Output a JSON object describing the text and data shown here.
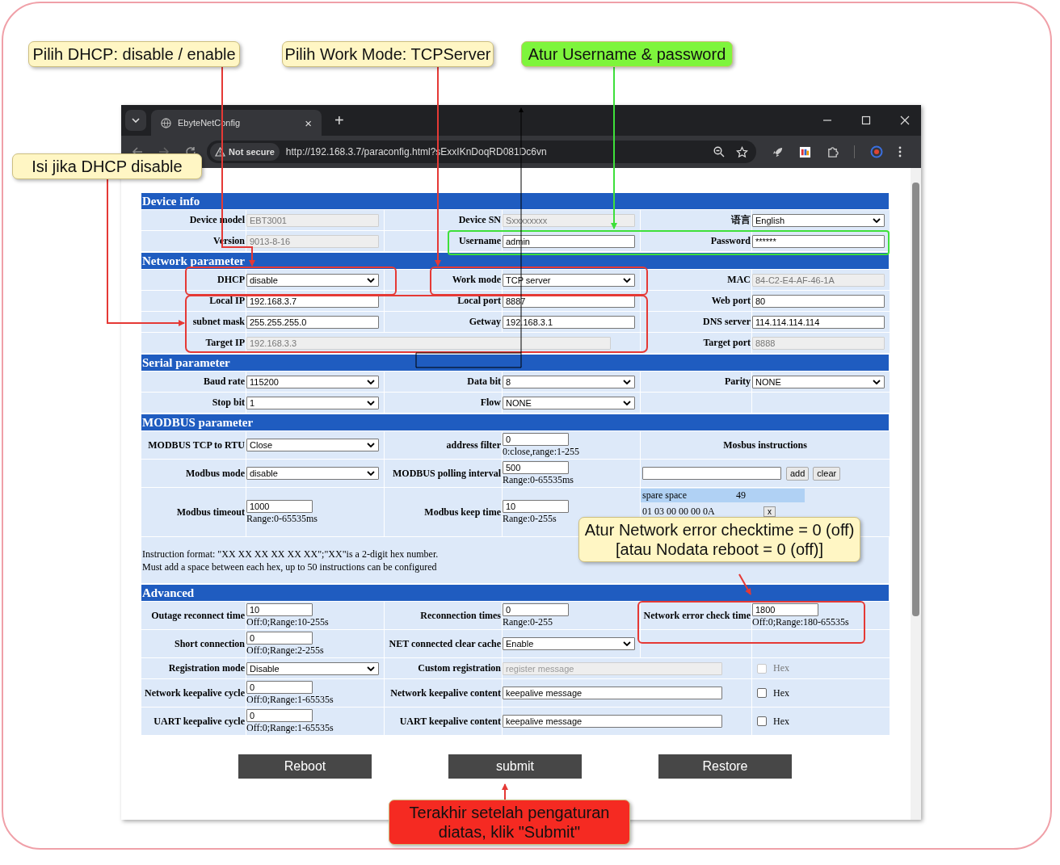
{
  "browser": {
    "tab_title": "EbyteNetConfig",
    "tab_close": "×",
    "new_tab": "+",
    "security": "Not secure",
    "url": "http://192.168.3.7/paraconfig.html?sExxIKnDoqRD081Dc6vn"
  },
  "sections": [
    {
      "title": "Device info",
      "rows": [
        [
          {
            "label": "Device model",
            "kind": "readonly",
            "value": "EBT3001"
          },
          {
            "label": "Device SN",
            "kind": "readonly",
            "value": "Sxxxxxxxx"
          },
          {
            "label": "语言",
            "kind": "select",
            "value": "English"
          }
        ],
        [
          {
            "label": "Version",
            "kind": "readonly",
            "value": "9013-8-16"
          },
          {
            "label": "Username",
            "kind": "input",
            "value": "admin"
          },
          {
            "label": "Password",
            "kind": "input",
            "value": "******"
          }
        ]
      ]
    },
    {
      "title": "Network parameter",
      "rows": [
        [
          {
            "label": "DHCP",
            "kind": "select",
            "value": "disable"
          },
          {
            "label": "Work mode",
            "kind": "select",
            "value": "TCP server"
          },
          {
            "label": "MAC",
            "kind": "readonly",
            "value": "84-C2-E4-AF-46-1A"
          }
        ],
        [
          {
            "label": "Local IP",
            "kind": "input",
            "value": "192.168.3.7"
          },
          {
            "label": "Local port",
            "kind": "input",
            "value": "8887"
          },
          {
            "label": "Web port",
            "kind": "input",
            "value": "80"
          }
        ],
        [
          {
            "label": "subnet mask",
            "kind": "input",
            "value": "255.255.255.0"
          },
          {
            "label": "Getway",
            "kind": "input",
            "value": "192.168.3.1"
          },
          {
            "label": "DNS server",
            "kind": "input",
            "value": "114.114.114.114"
          }
        ],
        [
          {
            "label": "Target IP",
            "kind": "readonly",
            "value": "192.168.3.3",
            "wide": true
          },
          null,
          {
            "label": "Target port",
            "kind": "readonly",
            "value": "8888"
          }
        ]
      ]
    },
    {
      "title": "Serial parameter",
      "rows": [
        [
          {
            "label": "Baud rate",
            "kind": "select",
            "value": "115200"
          },
          {
            "label": "Data bit",
            "kind": "select",
            "value": "8"
          },
          {
            "label": "Parity",
            "kind": "select",
            "value": "NONE"
          }
        ],
        [
          {
            "label": "Stop bit",
            "kind": "select",
            "value": "1"
          },
          {
            "label": "Flow",
            "kind": "select",
            "value": "NONE"
          },
          null
        ]
      ]
    },
    {
      "title": "MODBUS parameter",
      "rows": [
        [
          {
            "label": "MODBUS TCP to RTU",
            "kind": "select",
            "value": "Close"
          },
          {
            "label": "address filter",
            "kind": "input",
            "value": "0",
            "hint": "0:close,range:1-255"
          },
          {
            "label": "Mosbus instructions",
            "kind": "heading"
          }
        ],
        [
          {
            "label": "Modbus mode",
            "kind": "select",
            "value": "disable"
          },
          {
            "label": "MODBUS polling interval",
            "kind": "input",
            "value": "500",
            "hint": "Range:0-65535ms"
          },
          {
            "kind": "instr-entry",
            "buttons": [
              "add",
              "clear"
            ]
          }
        ],
        [
          {
            "label": "Modbus timeout",
            "kind": "input",
            "value": "1000",
            "hint": "Range:0-65535ms"
          },
          {
            "label": "Modbus keep time",
            "kind": "input",
            "value": "10",
            "hint": "Range:0-255s"
          },
          {
            "kind": "instr-list",
            "label": "spare space",
            "value": "49",
            "entries": [
              {
                "text": "01 03 00 00 00 0A",
                "button": "x"
              }
            ]
          }
        ]
      ],
      "note": [
        "Instruction format: \"XX XX XX XX XX XX\";\"XX\"is a 2-digit hex number.",
        "Must add a space between each hex, up to 50 instructions can be configured"
      ]
    },
    {
      "title": "Advanced",
      "rows": [
        [
          {
            "label": "Outage reconnect time",
            "kind": "input",
            "value": "10",
            "hint": "Off:0;Range:10-255s"
          },
          {
            "label": "Reconnection times",
            "kind": "input",
            "value": "0",
            "hint": "Range:0-255"
          },
          {
            "label": "Network error check time",
            "kind": "input",
            "value": "1800",
            "hint": "Off:0;Range:180-65535s"
          }
        ],
        [
          {
            "label": "Short connection",
            "kind": "input",
            "value": "0",
            "hint": "Off:0;Range:2-255s"
          },
          {
            "label": "NET connected clear cache",
            "kind": "select",
            "value": "Enable"
          },
          null
        ],
        [
          {
            "label": "Registration mode",
            "kind": "select",
            "value": "Disable"
          },
          {
            "label": "Custom registration",
            "kind": "readonly",
            "placeholder": "register message",
            "wide": true
          },
          {
            "kind": "checkbox",
            "text": "Hex",
            "checked": false,
            "disabled": true
          }
        ],
        [
          {
            "label": "Network keepalive cycle",
            "kind": "input",
            "value": "0",
            "hint": "Off:0;Range:1-65535s"
          },
          {
            "label": "Network keepalive content",
            "kind": "input",
            "value": "keepalive message",
            "wide": true
          },
          {
            "kind": "checkbox",
            "text": "Hex",
            "checked": false,
            "disabled": false
          }
        ],
        [
          {
            "label": "UART keepalive cycle",
            "kind": "input",
            "value": "0",
            "hint": "Off:0;Range:1-65535s"
          },
          {
            "label": "UART keepalive content",
            "kind": "input",
            "value": "keepalive message",
            "wide": true
          },
          {
            "kind": "checkbox",
            "text": "Hex",
            "checked": false,
            "disabled": false
          }
        ]
      ]
    }
  ],
  "buttons": [
    "Reboot",
    "submit",
    "Restore"
  ],
  "annotations": [
    {
      "lines": [
        "Pilih DHCP: disable / enable"
      ],
      "color": "#fff6c4"
    },
    {
      "lines": [
        "Pilih Work Mode: TCPServer"
      ],
      "color": "#fff6c4"
    },
    {
      "lines": [
        "Atur Username & password"
      ],
      "color": "#7ef53c"
    },
    {
      "lines": [
        "Isi jika DHCP disable"
      ],
      "color": "#fff6c4"
    },
    {
      "lines": [
        "Atur Network error checktime = 0 (off)",
        "[atau Nodata reboot = 0 (off)]"
      ],
      "color": "#fff6c4"
    },
    {
      "lines": [
        "Terakhir setelah pengaturan",
        "diatas, klik \"Submit\""
      ],
      "color": "#f52a22"
    }
  ]
}
